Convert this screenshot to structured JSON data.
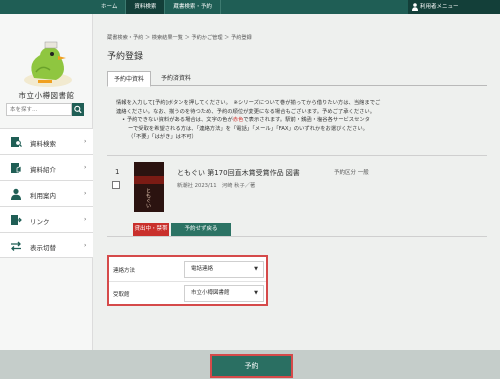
{
  "topnav": {
    "home": "ホーム",
    "catalog": "資料検索",
    "search_reserve": "蔵書検索・予約",
    "user_menu": "利用者メニュー"
  },
  "sidebar": {
    "library_name": "市立小樽図書館",
    "search_placeholder": "本を探す…",
    "items": [
      {
        "label": "資料検索",
        "icon": "book-search-icon"
      },
      {
        "label": "資料紹介",
        "icon": "book-intro-icon"
      },
      {
        "label": "利用案内",
        "icon": "person-icon"
      },
      {
        "label": "リンク",
        "icon": "link-icon"
      },
      {
        "label": "表示切替",
        "icon": "swap-icon"
      }
    ]
  },
  "breadcrumb": "蔵書検索・予約 ＞ 検索結果一覧 ＞ 予約かご管理 ＞ 予約登録",
  "page_title": "予約登録",
  "tabs": [
    "予約中資料",
    "予約済資料"
  ],
  "notice": {
    "l1": "情報を入力して[予約]ボタンを押してください。　※シリーズについて巻が揃ってから借りたい方は、当館までご",
    "l2": "連絡ください。なお、揃うのを待つため、予約の順位が変更になる場合もございます。予めご了承ください。",
    "l3a": "予約できない資料がある場合は、文字の色が",
    "l3red": "赤色",
    "l3b": "で表示されます。駅前・銭函・塩谷各サービスセンタ",
    "l4": "ーで受取を希望される方は、「連絡方法」を「電話」「メール」「FAX」のいずれかをお選びください。",
    "l5": "（「不要」「はがき」は不可）"
  },
  "book": {
    "number": "1",
    "cover_text": "ともぐい",
    "title": "ともぐい 第170回直木賞受賞作品 図書",
    "meta": "新潮社 2023/11　河崎 秋子／著",
    "section": "予約区分 一般",
    "status": "貸出中・禁帯",
    "cancel_button": "予約せず戻る"
  },
  "form": {
    "contact_label": "連絡方法",
    "contact_value": "電話連絡",
    "pickup_label": "受取館",
    "pickup_value": "市立小樽図書館"
  },
  "submit_label": "予約",
  "colors": {
    "brand": "#1f5e55",
    "accent": "#d54a4a",
    "button": "#2a6f62"
  }
}
